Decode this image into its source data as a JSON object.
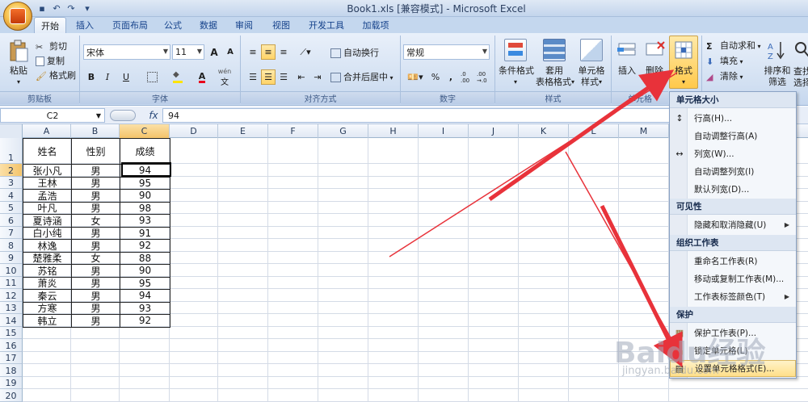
{
  "window": {
    "title": "Book1.xls  [兼容模式] - Microsoft Excel"
  },
  "tabs": [
    {
      "label": "开始",
      "active": true
    },
    {
      "label": "插入"
    },
    {
      "label": "页面布局"
    },
    {
      "label": "公式"
    },
    {
      "label": "数据"
    },
    {
      "label": "审阅"
    },
    {
      "label": "视图"
    },
    {
      "label": "开发工具"
    },
    {
      "label": "加载项"
    }
  ],
  "ribbon": {
    "clipboard": {
      "paste": "粘贴",
      "cut": "剪切",
      "copy": "复制",
      "painter": "格式刷",
      "label": "剪贴板"
    },
    "font": {
      "name": "宋体",
      "size": "11",
      "bold": "B",
      "italic": "I",
      "underline": "U",
      "grow": "A",
      "shrink": "A",
      "label": "字体",
      "wen": "wén"
    },
    "alignment": {
      "wrap": "自动换行",
      "merge": "合并后居中",
      "label": "对齐方式"
    },
    "number": {
      "format": "常规",
      "percent": "%",
      "comma": ",",
      "inc": ".0 .00",
      "dec": ".00 →.0",
      "label": "数字"
    },
    "styles": {
      "cond": "条件格式",
      "table_a": "套用",
      "table_b": "表格格式",
      "cellstyle_a": "单元格",
      "cellstyle_b": "样式",
      "label": "样式"
    },
    "cells": {
      "insert": "插入",
      "delete": "删除",
      "format": "格式",
      "label": "单元格"
    },
    "editing": {
      "autosum": "自动求和",
      "fill": "填充",
      "clear": "清除",
      "sort_a": "排序和",
      "sort_b": "筛选",
      "find_a": "查找",
      "find_b": "选择"
    }
  },
  "formula_bar": {
    "name_box": "C2",
    "fx": "fx",
    "value": "94"
  },
  "columns": [
    "A",
    "B",
    "C",
    "D",
    "E",
    "F",
    "G",
    "H",
    "I",
    "J",
    "K",
    "L",
    "M"
  ],
  "rows": [
    "1",
    "2",
    "3",
    "4",
    "5",
    "6",
    "7",
    "8",
    "9",
    "10",
    "11",
    "12",
    "13",
    "14",
    "15",
    "16",
    "17",
    "18",
    "19",
    "20"
  ],
  "table": {
    "headers": [
      "姓名",
      "性别",
      "成绩"
    ],
    "rows": [
      [
        "张小凡",
        "男",
        "94"
      ],
      [
        "王林",
        "男",
        "95"
      ],
      [
        "孟浩",
        "男",
        "90"
      ],
      [
        "叶凡",
        "男",
        "98"
      ],
      [
        "夏诗涵",
        "女",
        "93"
      ],
      [
        "白小纯",
        "男",
        "91"
      ],
      [
        "林逸",
        "男",
        "92"
      ],
      [
        "楚雅柔",
        "女",
        "88"
      ],
      [
        "苏铭",
        "男",
        "90"
      ],
      [
        "萧炎",
        "男",
        "95"
      ],
      [
        "秦云",
        "男",
        "94"
      ],
      [
        "方寒",
        "男",
        "93"
      ],
      [
        "韩立",
        "男",
        "92"
      ]
    ]
  },
  "format_menu": {
    "sections": [
      {
        "title": "单元格大小",
        "items": [
          "行高(H)...",
          "自动调整行高(A)",
          "列宽(W)...",
          "自动调整列宽(I)",
          "默认列宽(D)..."
        ]
      },
      {
        "title": "可见性",
        "items": [
          "隐藏和取消隐藏(U)"
        ]
      },
      {
        "title": "组织工作表",
        "items": [
          "重命名工作表(R)",
          "移动或复制工作表(M)...",
          "工作表标签颜色(T)"
        ]
      },
      {
        "title": "保护",
        "items": [
          "保护工作表(P)...",
          "锁定单元格(L)",
          "设置单元格格式(E)..."
        ]
      }
    ]
  },
  "watermark": {
    "brand": "Baidu经验",
    "url": "jingyan.baidu.com"
  },
  "colors": {
    "arrow": "#e8323a",
    "selection": "#f4c46a",
    "ribbon": "#d2e0f2"
  }
}
